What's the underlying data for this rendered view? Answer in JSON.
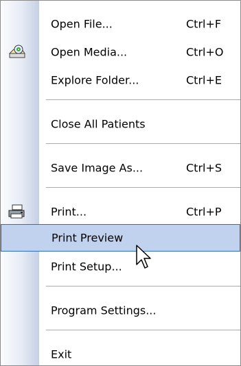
{
  "menu": {
    "items": [
      {
        "label": "Open File...",
        "shortcut": "Ctrl+F"
      },
      {
        "label": "Open Media...",
        "shortcut": "Ctrl+O",
        "icon": "media-disc-icon"
      },
      {
        "label": "Explore Folder...",
        "shortcut": "Ctrl+E"
      },
      {
        "label": "Close All Patients",
        "shortcut": ""
      },
      {
        "label": "Save Image As...",
        "shortcut": "Ctrl+S"
      },
      {
        "label": "Print...",
        "shortcut": "Ctrl+P",
        "icon": "printer-icon"
      },
      {
        "label": "Print Preview",
        "shortcut": "",
        "highlighted": true
      },
      {
        "label": "Print Setup...",
        "shortcut": ""
      },
      {
        "label": "Program Settings...",
        "shortcut": ""
      },
      {
        "label": "Exit",
        "shortcut": ""
      }
    ]
  },
  "colors": {
    "highlight_fill": "#c1d2ee",
    "highlight_border": "#316ac5",
    "separator": "#a7aaae"
  }
}
